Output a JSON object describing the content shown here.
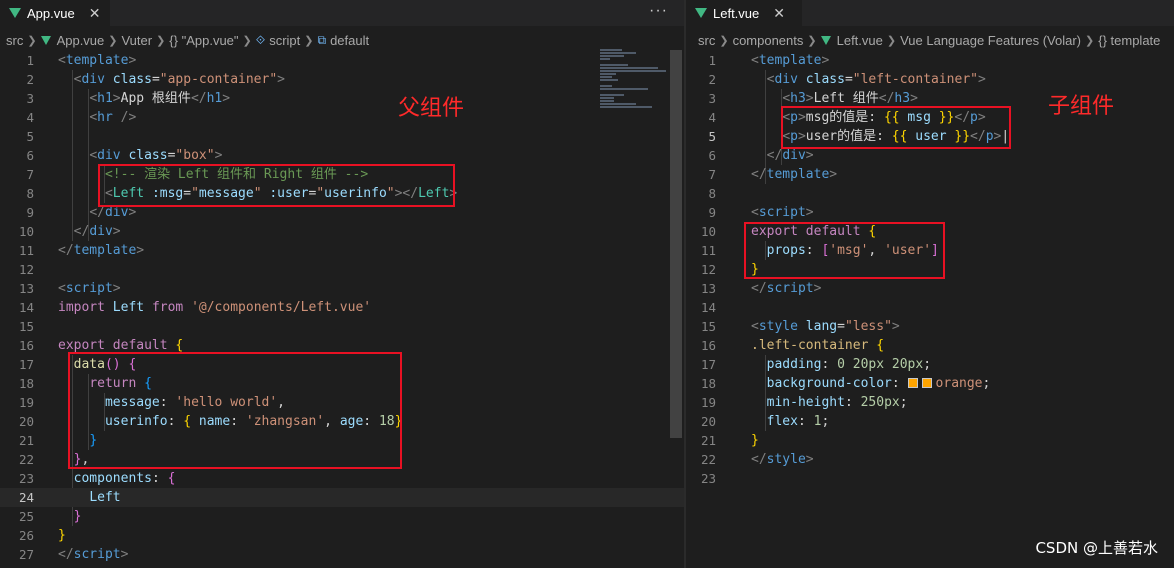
{
  "left": {
    "tab": {
      "label": "App.vue",
      "close": "✕",
      "icon": "vue-logo"
    },
    "more": "···",
    "breadcrumbs": [
      "src",
      "App.vue",
      "Vuter",
      "{} \"App.vue\"",
      "script",
      "default"
    ],
    "annotation": "父组件",
    "lines": [
      {
        "n": "1"
      },
      {
        "n": "2"
      },
      {
        "n": "3"
      },
      {
        "n": "4"
      },
      {
        "n": "5"
      },
      {
        "n": "6"
      },
      {
        "n": "7"
      },
      {
        "n": "8"
      },
      {
        "n": "9"
      },
      {
        "n": "10"
      },
      {
        "n": "11"
      },
      {
        "n": "12"
      },
      {
        "n": "13"
      },
      {
        "n": "14"
      },
      {
        "n": "15"
      },
      {
        "n": "16"
      },
      {
        "n": "17"
      },
      {
        "n": "18"
      },
      {
        "n": "19"
      },
      {
        "n": "20"
      },
      {
        "n": "21"
      },
      {
        "n": "22"
      },
      {
        "n": "23"
      },
      {
        "n": "24"
      },
      {
        "n": "25"
      },
      {
        "n": "26"
      },
      {
        "n": "27"
      }
    ],
    "code": {
      "l3_text": "App 根组件",
      "l7_comment": "<!-- 渲染 Left 组件和 Right 组件 -->",
      "l14_path": "'@/components/Left.vue'",
      "l19_value": "'hello world'",
      "l20_name": "'zhangsan'",
      "l20_age": "18"
    }
  },
  "right": {
    "tab": {
      "label": "Left.vue",
      "close": "✕",
      "icon": "vue-logo"
    },
    "breadcrumbs": [
      "src",
      "components",
      "Left.vue",
      "Vue Language Features (Volar)",
      "{} template"
    ],
    "annotation": "子组件",
    "lines": [
      {
        "n": "1"
      },
      {
        "n": "2"
      },
      {
        "n": "3"
      },
      {
        "n": "4"
      },
      {
        "n": "5"
      },
      {
        "n": "6"
      },
      {
        "n": "7"
      },
      {
        "n": "8"
      },
      {
        "n": "9"
      },
      {
        "n": "10"
      },
      {
        "n": "11"
      },
      {
        "n": "12"
      },
      {
        "n": "13"
      },
      {
        "n": "14"
      },
      {
        "n": "15"
      },
      {
        "n": "16"
      },
      {
        "n": "17"
      },
      {
        "n": "18"
      },
      {
        "n": "19"
      },
      {
        "n": "20"
      },
      {
        "n": "21"
      },
      {
        "n": "22"
      },
      {
        "n": "23"
      }
    ],
    "code": {
      "l3_text": "Left 组件",
      "l4_text": "msg的值是: ",
      "l5_text": "user的值是: ",
      "l11_msg": "'msg'",
      "l11_user": "'user'",
      "l15_lang": "\"less\"",
      "l19_color": "orange"
    }
  },
  "watermark": "CSDN @上善若水",
  "colors": {
    "highlight_box": "#e81123",
    "annotation": "#ff2a2a",
    "background": "#1e1e1e"
  }
}
